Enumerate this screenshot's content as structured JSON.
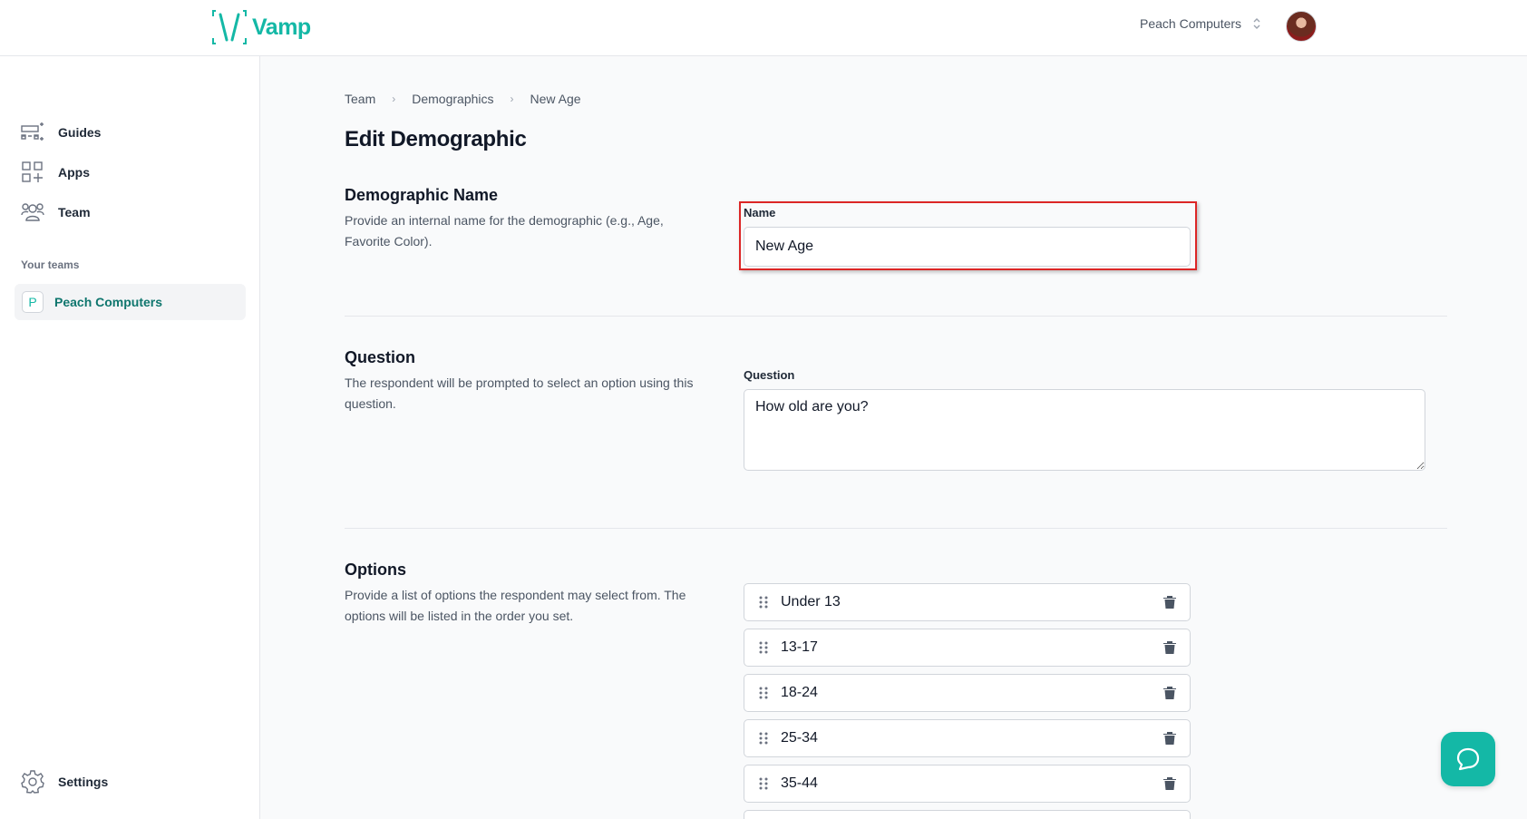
{
  "app": {
    "name": "Vamp",
    "brand_color": "#14b8a6"
  },
  "header": {
    "org_name": "Peach Computers"
  },
  "sidebar": {
    "items": [
      {
        "label": "Guides",
        "icon": "guides-icon"
      },
      {
        "label": "Apps",
        "icon": "apps-icon"
      },
      {
        "label": "Team",
        "icon": "team-icon"
      }
    ],
    "teams_heading": "Your teams",
    "team": {
      "badge": "P",
      "name": "Peach Computers"
    },
    "settings_label": "Settings"
  },
  "breadcrumb": [
    "Team",
    "Demographics",
    "New Age"
  ],
  "page_title": "Edit Demographic",
  "sections": {
    "name": {
      "title": "Demographic Name",
      "description": "Provide an internal name for the demographic (e.g., Age, Favorite Color).",
      "field_label": "Name",
      "value": "New Age"
    },
    "question": {
      "title": "Question",
      "description": "The respondent will be prompted to select an option using this question.",
      "field_label": "Question",
      "value": "How old are you?"
    },
    "options": {
      "title": "Options",
      "description": "Provide a list of options the respondent may select from. The options will be listed in the order you set.",
      "items": [
        "Under 13",
        "13-17",
        "18-24",
        "25-34",
        "35-44"
      ]
    }
  }
}
